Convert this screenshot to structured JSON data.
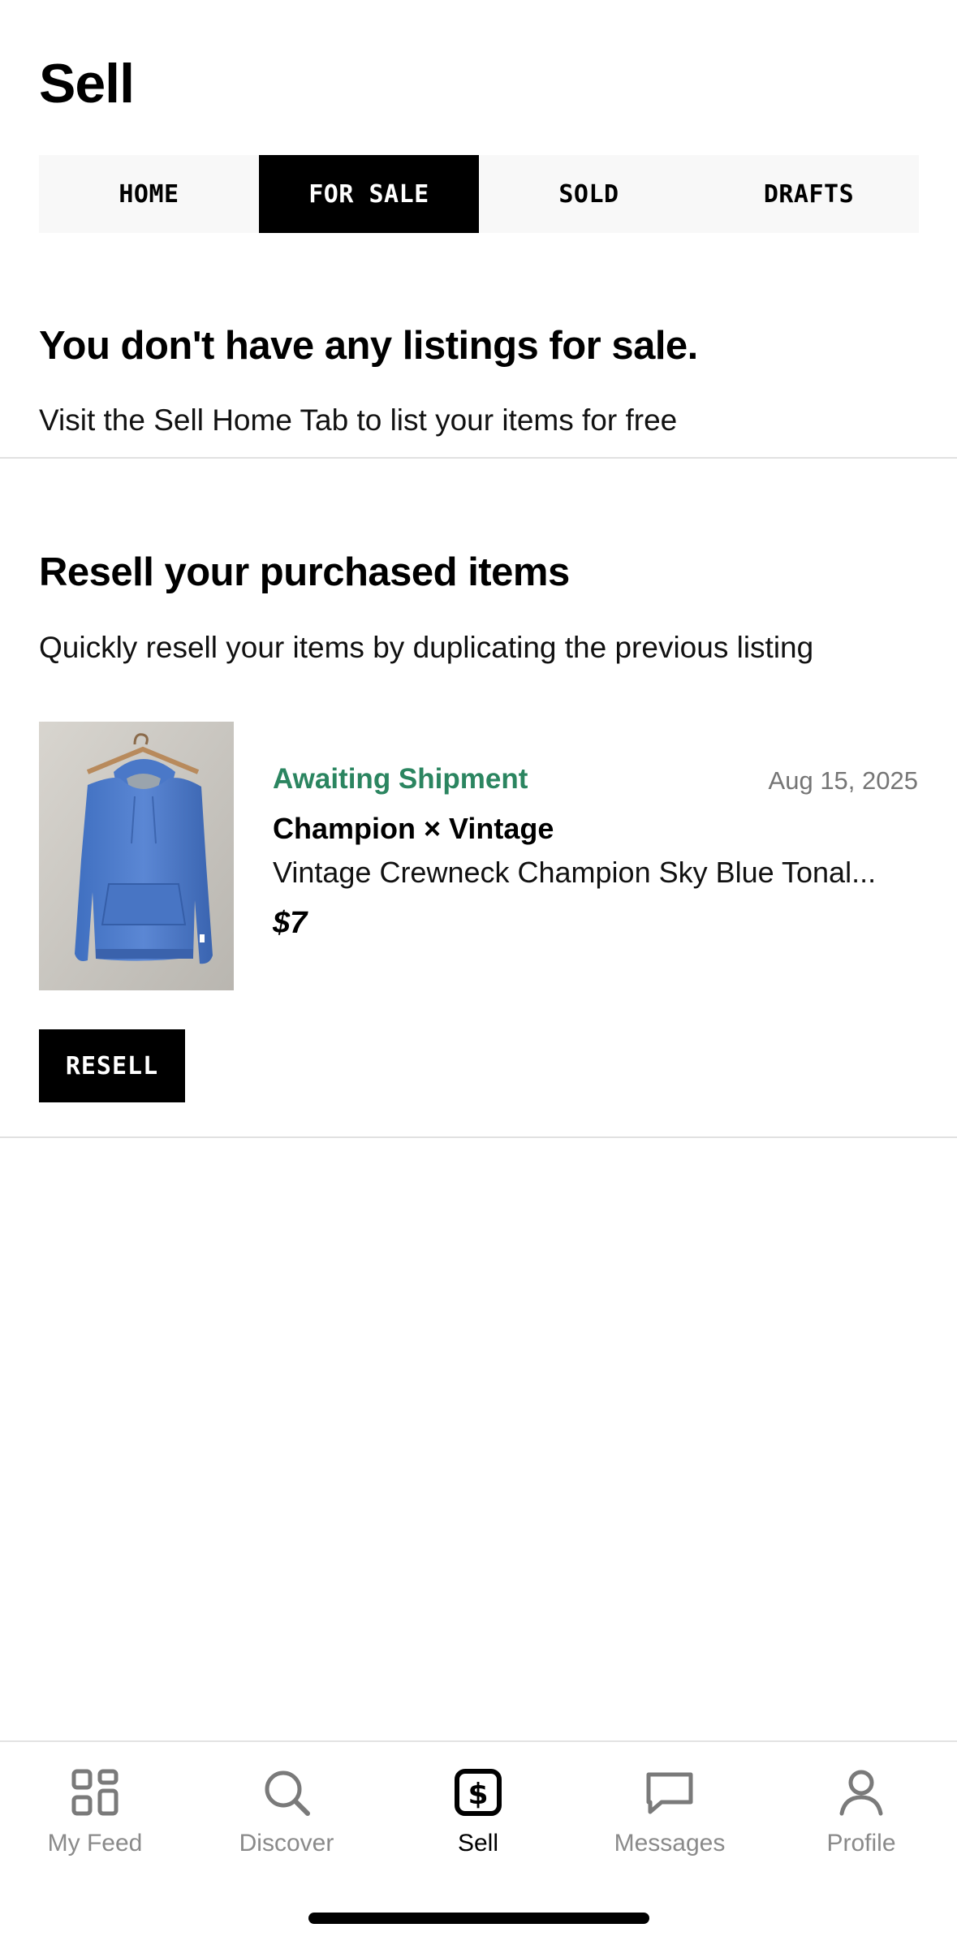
{
  "header": {
    "title": "Sell"
  },
  "tabs": [
    {
      "label": "HOME",
      "active": false
    },
    {
      "label": "FOR SALE",
      "active": true
    },
    {
      "label": "SOLD",
      "active": false
    },
    {
      "label": "DRAFTS",
      "active": false
    }
  ],
  "empty_state": {
    "title": "You don't have any listings for sale.",
    "subtitle": "Visit the Sell Home Tab to list your items for free"
  },
  "resell": {
    "title": "Resell your purchased items",
    "subtitle": "Quickly resell your items by duplicating the previous listing",
    "item": {
      "status": "Awaiting Shipment",
      "date": "Aug 15, 2025",
      "brand": "Champion × Vintage",
      "description": "Vintage Crewneck Champion Sky Blue Tonal...",
      "price": "$7"
    },
    "button_label": "RESELL"
  },
  "bottom_nav": {
    "items": [
      {
        "label": "My Feed",
        "icon": "grid-icon",
        "active": false
      },
      {
        "label": "Discover",
        "icon": "search-icon",
        "active": false
      },
      {
        "label": "Sell",
        "icon": "dollar-tag-icon",
        "active": true
      },
      {
        "label": "Messages",
        "icon": "chat-bubble-icon",
        "active": false
      },
      {
        "label": "Profile",
        "icon": "person-icon",
        "active": false
      }
    ]
  },
  "colors": {
    "accent_status": "#2b8560",
    "active_tab_bg": "#000000",
    "inactive_nav": "#8a8a8a"
  }
}
